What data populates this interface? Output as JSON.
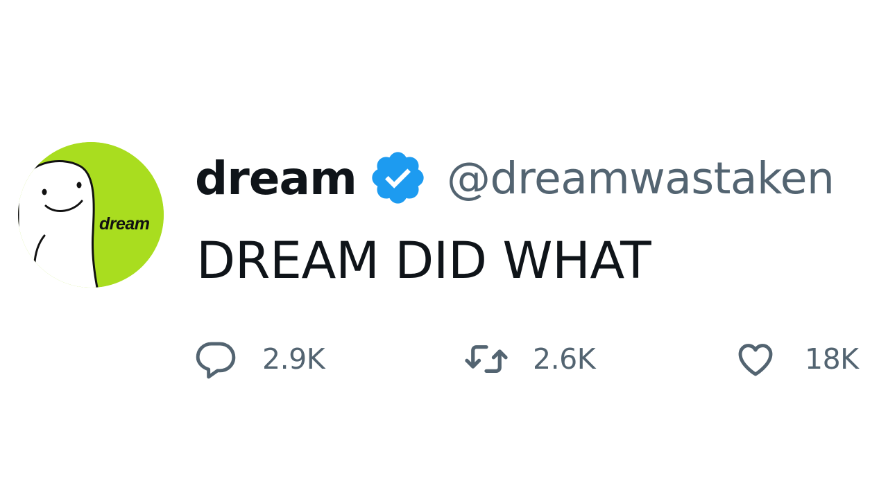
{
  "tweet": {
    "author": {
      "display_name": "dream",
      "handle": "@dreamwastaken",
      "verified": true,
      "avatar_label": "dream",
      "avatar_color": "#a9dd1f"
    },
    "text": "DREAM DID WHAT",
    "actions": {
      "replies": {
        "icon": "reply-icon",
        "count": "2.9K"
      },
      "retweets": {
        "icon": "retweet-icon",
        "count": "2.6K"
      },
      "likes": {
        "icon": "heart-icon",
        "count": "18K"
      }
    }
  },
  "colors": {
    "text_primary": "#0f1419",
    "text_secondary": "#536471",
    "verified_blue": "#1d9bf0",
    "background": "#ffffff"
  }
}
